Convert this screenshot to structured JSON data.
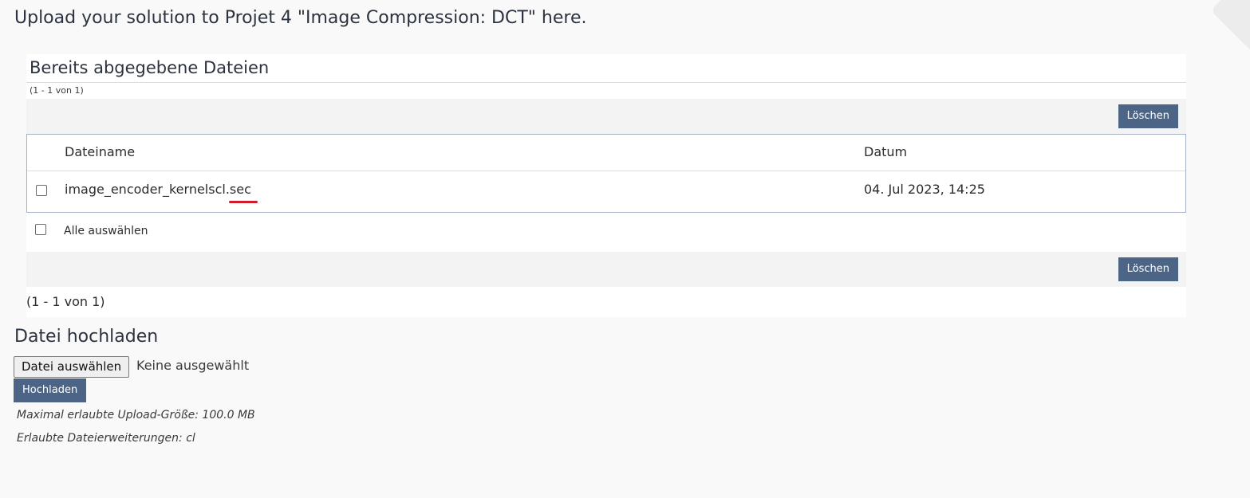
{
  "intro": "Upload your solution to Projet 4 \"Image Compression: DCT\" here.",
  "submitted": {
    "title": "Bereits abgegebene Dateien",
    "range_top": "(1 - 1 von 1)",
    "delete_label": "Löschen",
    "columns": {
      "name": "Dateiname",
      "date": "Datum"
    },
    "rows": [
      {
        "name": "image_encoder_kernelscl.sec",
        "date": "04. Jul 2023, 14:25"
      }
    ],
    "select_all": "Alle auswählen",
    "range_bottom": "(1 - 1 von 1)"
  },
  "upload": {
    "title": "Datei hochladen",
    "choose_label": "Datei auswählen",
    "no_file": "Keine ausgewählt",
    "submit_label": "Hochladen",
    "max_size": "Maximal erlaubte Upload-Größe: 100.0 MB",
    "extensions": "Erlaubte Dateierweiterungen: cl"
  },
  "colors": {
    "button_bg": "#4c6586",
    "annotation_underline": "#d11a2a"
  }
}
